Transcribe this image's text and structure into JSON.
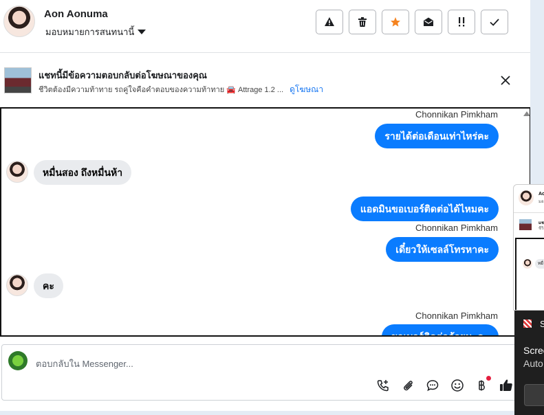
{
  "header": {
    "contact_name": "Aon Aonuma",
    "assign_label": "มอบหมายการสนทนานี้",
    "actions": [
      {
        "name": "report-button",
        "icon": "warning-icon",
        "glyph": "▲"
      },
      {
        "name": "delete-button",
        "icon": "trash-icon",
        "glyph": "🗑"
      },
      {
        "name": "star-button",
        "icon": "star-icon",
        "glyph": "★",
        "color": "#f5831f"
      },
      {
        "name": "mark-unread-button",
        "icon": "envelope-open-icon",
        "glyph": "✉"
      },
      {
        "name": "follow-up-button",
        "icon": "exclamation-icon",
        "glyph": "!!"
      },
      {
        "name": "mark-done-button",
        "icon": "check-icon",
        "glyph": "✓"
      }
    ]
  },
  "ad_banner": {
    "title": "แชทนี้มีข้อความตอบกลับต่อโฆษณาของคุณ",
    "subtitle": "ชีวิตต้องมีความท้าทาย รถคู่ใจคือคำตอบของความท้าทาย 🚘 Attrage 1.2 ...",
    "link": "ดูโฆษณา"
  },
  "messages": {
    "sender_1": "Chonnikan Pimkham",
    "out_1": "รายได้ต่อเดือนเท่าไหร่คะ",
    "in_1": "หมื่นสอง ถึงหมื่นห้า",
    "out_2": "แอดมินขอเบอร์ติดต่อได้ไหมคะ",
    "sender_2": "Chonnikan Pimkham",
    "out_3": "เดี๋ยวให้เซลล์โทรหาคะ",
    "in_2": "คะ",
    "sender_3": "Chonnikan Pimkham",
    "out_4": "ขอเบอร์ติดต่อด้วยนะคะ"
  },
  "composer": {
    "placeholder": "ตอบกลับใน Messenger..."
  },
  "mini_window": {
    "name": "Ao",
    "sub": "มอ",
    "ad1": "แชท",
    "ad2": "ชีวิต",
    "bubble": "หมื่"
  },
  "toast": {
    "head": "S",
    "line1": "Scree",
    "line2": "Auto"
  },
  "colors": {
    "accent": "#0a7cff",
    "star": "#f5831f",
    "link": "#1877f2"
  }
}
